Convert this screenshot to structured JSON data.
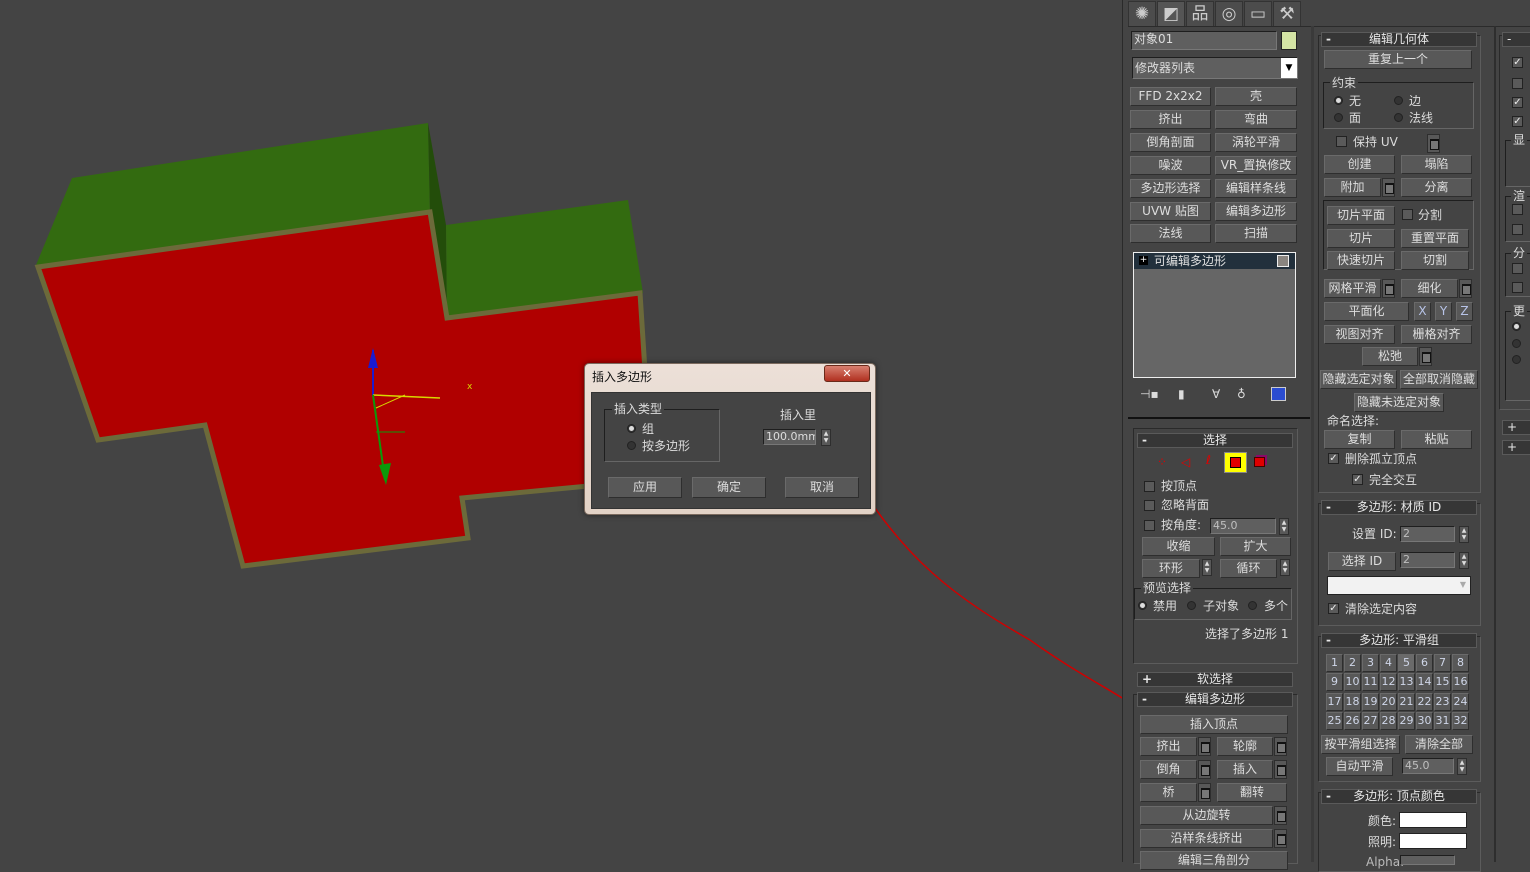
{
  "viewport": {
    "axis_x_label": "x"
  },
  "panel": {
    "tabs": [
      {
        "icon": "create-icon"
      },
      {
        "icon": "modify-icon"
      },
      {
        "icon": "hierarchy-icon"
      },
      {
        "icon": "motion-icon"
      },
      {
        "icon": "display-icon"
      },
      {
        "icon": "utilities-icon"
      }
    ],
    "object_name": "对象01",
    "object_color": "#d4e4a4",
    "modifier_list": "修改器列表",
    "modifier_buttons": [
      "FFD 2x2x2",
      "壳",
      "挤出",
      "弯曲",
      "倒角剖面",
      "涡轮平滑",
      "噪波",
      "VR_置换修改",
      "多边形选择",
      "编辑样条线",
      "UVW 贴图",
      "编辑多边形",
      "法线",
      "扫描"
    ],
    "stack": [
      "可编辑多边形"
    ],
    "selection": {
      "title": "选择",
      "by_vertex": "按顶点",
      "ignore_backfacing": "忽略背面",
      "by_angle": "按角度:",
      "angle": "45.0",
      "shrink": "收缩",
      "grow": "扩大",
      "ring": "环形",
      "loop": "循环",
      "preview_title": "预览选择",
      "preview_options": [
        "禁用",
        "子对象",
        "多个"
      ],
      "status": "选择了多边形 1"
    },
    "soft_selection": {
      "title": "软选择"
    },
    "edit_polygons": {
      "title": "编辑多边形",
      "insert_vertex": "插入顶点",
      "extrude": "挤出",
      "outline": "轮廓",
      "bevel": "倒角",
      "inset": "插入",
      "bridge": "桥",
      "flip": "翻转",
      "hinge": "从边旋转",
      "extrude_spline": "沿样条线挤出",
      "edit_tri": "编辑三角剖分"
    },
    "edit_geometry": {
      "title": "编辑几何体",
      "repeat_last": "重复上一个",
      "constraints_title": "约束",
      "constraints": [
        "无",
        "边",
        "面",
        "法线"
      ],
      "preserve_uv": "保持 UV",
      "create": "创建",
      "collapse": "塌陷",
      "attach": "附加",
      "detach": "分离",
      "slice_plane": "切片平面",
      "split": "分割",
      "slice": "切片",
      "reset_plane": "重置平面",
      "quickslice": "快速切片",
      "cut": "切割",
      "meshsmooth": "网格平滑",
      "tessellate": "细化",
      "make_planar": "平面化",
      "x": "X",
      "y": "Y",
      "z": "Z",
      "view_align": "视图对齐",
      "grid_align": "栅格对齐",
      "relax": "松弛",
      "hide_selected": "隐藏选定对象",
      "unhide_all": "全部取消隐藏",
      "hide_unselected": "隐藏未选定对象",
      "named_sel": "命名选择:",
      "copy": "复制",
      "paste": "粘贴",
      "delete_isolated": "删除孤立顶点",
      "full_interactivity": "完全交互"
    },
    "material_ids": {
      "title": "多边形: 材质 ID",
      "set_id_label": "设置 ID:",
      "set_id": "2",
      "select_id": "选择 ID",
      "select_id_value": "2",
      "clear_selection": "清除选定内容"
    },
    "smoothing_groups": {
      "title": "多边形: 平滑组",
      "groups": [
        "1",
        "2",
        "3",
        "4",
        "5",
        "6",
        "7",
        "8",
        "9",
        "10",
        "11",
        "12",
        "13",
        "14",
        "15",
        "16",
        "17",
        "18",
        "19",
        "20",
        "21",
        "22",
        "23",
        "24",
        "25",
        "26",
        "27",
        "28",
        "29",
        "30",
        "31",
        "32"
      ],
      "select_by_sg": "按平滑组选择",
      "clear_all": "清除全部",
      "auto_smooth": "自动平滑",
      "threshold": "45.0"
    },
    "vertex_colors": {
      "title": "多边形: 顶点颜色",
      "color": "颜色:",
      "illumination": "照明:",
      "alpha": "Alpha:"
    },
    "col3": {
      "group_labels": [
        "显",
        "渲",
        "分",
        "更"
      ]
    }
  },
  "dialog": {
    "title": "插入多边形",
    "close": "✕",
    "inset_type": "插入类型",
    "type_options": [
      "组",
      "按多边形"
    ],
    "amount_label": "插入里",
    "amount": "100.0mm",
    "apply": "应用",
    "ok": "确定",
    "cancel": "取消"
  }
}
